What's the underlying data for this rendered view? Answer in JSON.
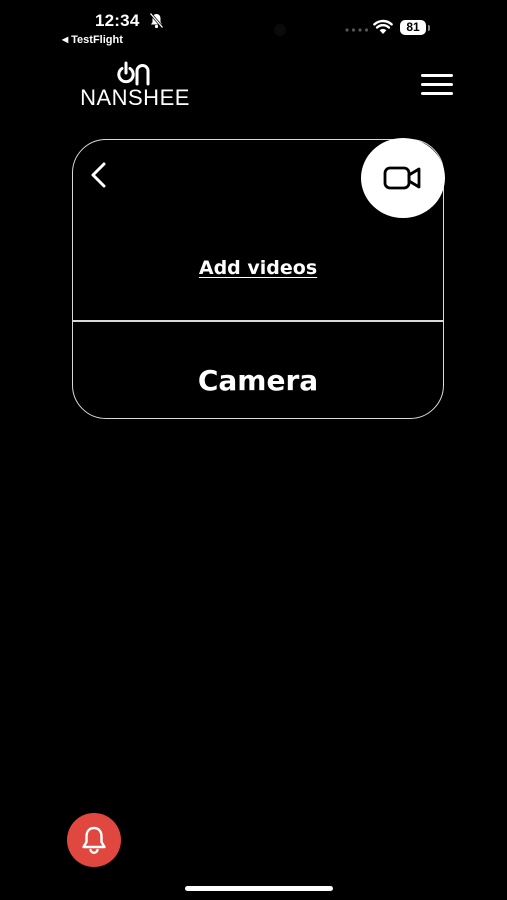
{
  "status_bar": {
    "time": "12:34",
    "back_app": "TestFlight",
    "back_icon": "◀",
    "battery": "81",
    "icons": [
      "bell-slash-icon",
      "cellular-icon",
      "wifi-icon",
      "battery-icon"
    ]
  },
  "header": {
    "logo_text": "NANSHEE",
    "logo_mark": "on",
    "menu_icon": "hamburger-menu-icon"
  },
  "card": {
    "back_icon": "chevron-left-icon",
    "fab_icon": "video-camera-icon",
    "add_videos_label": "Add videos",
    "camera_label": "Camera"
  },
  "bottom": {
    "notification_icon": "bell-icon",
    "notification_color": "#e0473e"
  }
}
